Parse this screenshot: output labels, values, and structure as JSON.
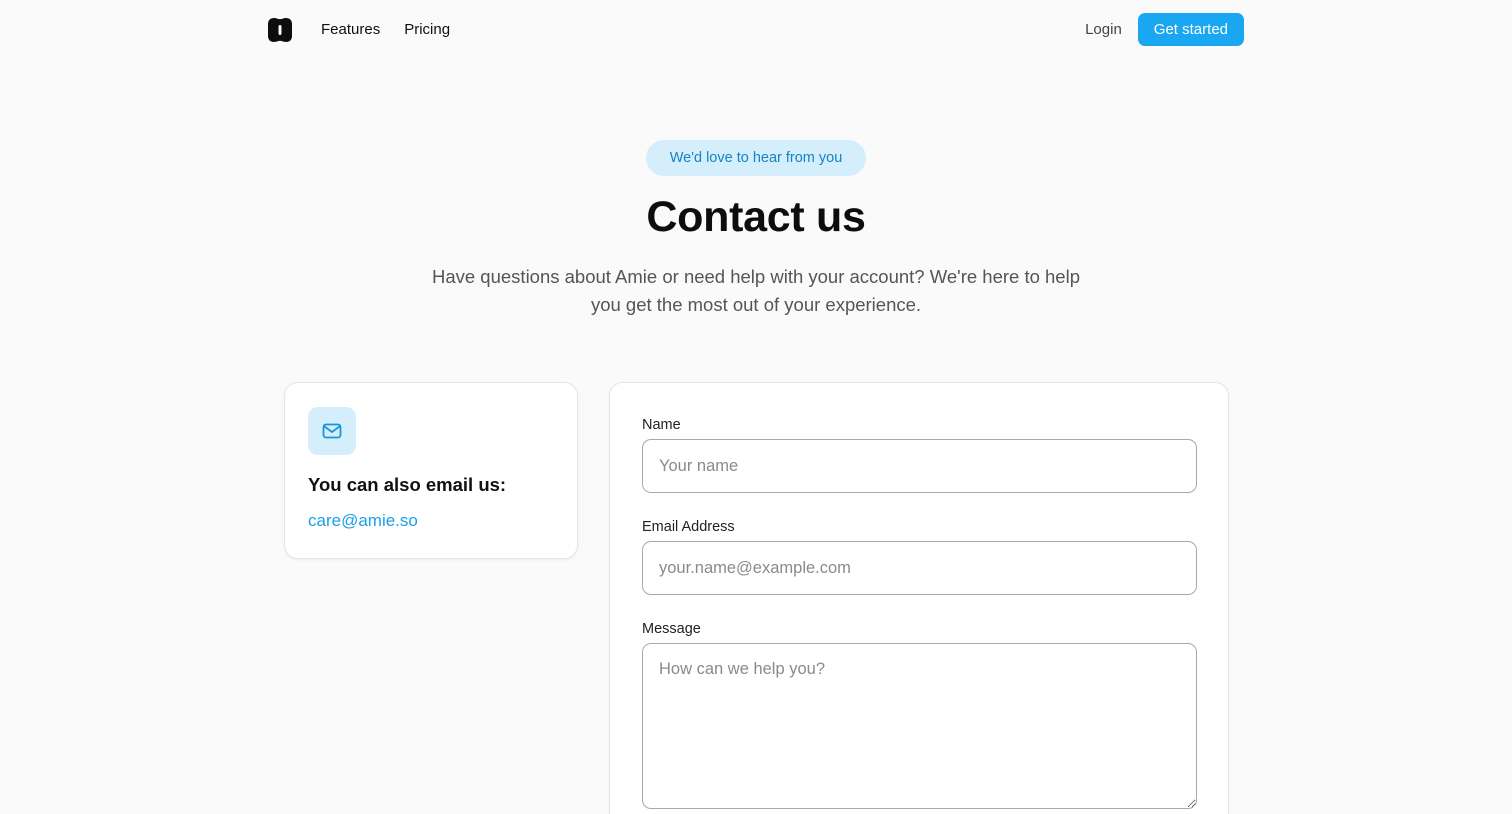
{
  "nav": {
    "logo_icon": "app-logo-icon",
    "links": [
      {
        "label": "Features"
      },
      {
        "label": "Pricing"
      }
    ],
    "login_label": "Login",
    "cta_label": "Get started"
  },
  "hero": {
    "pill_text": "We'd love to hear from you",
    "title": "Contact us",
    "subtitle": "Have questions about Amie or need help with your account? We're here to help you get the most out of your experience."
  },
  "email_card": {
    "icon": "mail-icon",
    "heading": "You can also email us:",
    "email": "care@amie.so"
  },
  "form": {
    "name": {
      "label": "Name",
      "placeholder": "Your name",
      "value": ""
    },
    "email": {
      "label": "Email Address",
      "placeholder": "your.name@example.com",
      "value": ""
    },
    "message": {
      "label": "Message",
      "placeholder": "How can we help you?",
      "value": ""
    }
  },
  "colors": {
    "accent": "#1aa7f2",
    "accent_light": "#d4eefc",
    "accent_text": "#1783c6",
    "background": "#fafafa"
  }
}
